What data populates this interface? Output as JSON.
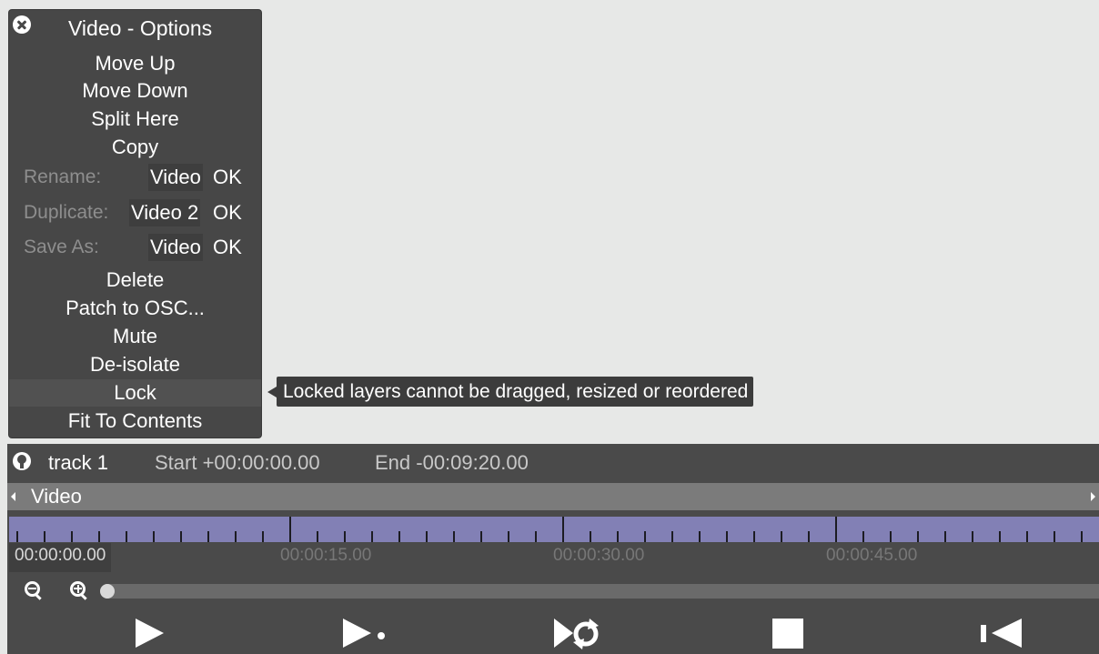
{
  "menu": {
    "title": "Video - Options",
    "items": {
      "move_up": "Move Up",
      "move_down": "Move Down",
      "split_here": "Split Here",
      "copy": "Copy",
      "delete": "Delete",
      "patch_osc": "Patch to OSC...",
      "mute": "Mute",
      "deisolate": "De-isolate",
      "lock": "Lock",
      "fit": "Fit To Contents"
    },
    "rename": {
      "label": "Rename:",
      "value": "Video",
      "ok": "OK"
    },
    "duplicate": {
      "label": "Duplicate:",
      "value": "Video 2",
      "ok": "OK"
    },
    "save_as": {
      "label": "Save As:",
      "value": "Video",
      "ok": "OK"
    }
  },
  "tooltip": "Locked layers cannot be dragged, resized or reordered",
  "track": {
    "name": "track 1",
    "start": "Start +00:00:00.00",
    "end": "End -00:09:20.00",
    "layer": "Video",
    "timecodes": [
      "00:00:00.00",
      "00:00:15.00",
      "00:00:30.00",
      "00:00:45.00"
    ],
    "zoom_level": 0
  },
  "colors": {
    "menu_bg": "#474747",
    "ruler": "#8280b5",
    "background": "#e7e8e7"
  },
  "icons": [
    "close-icon",
    "location-pin-icon",
    "zoom-out-icon",
    "zoom-in-icon",
    "play-icon",
    "play-next-icon",
    "loop-icon",
    "stop-icon",
    "skip-to-start-icon"
  ]
}
